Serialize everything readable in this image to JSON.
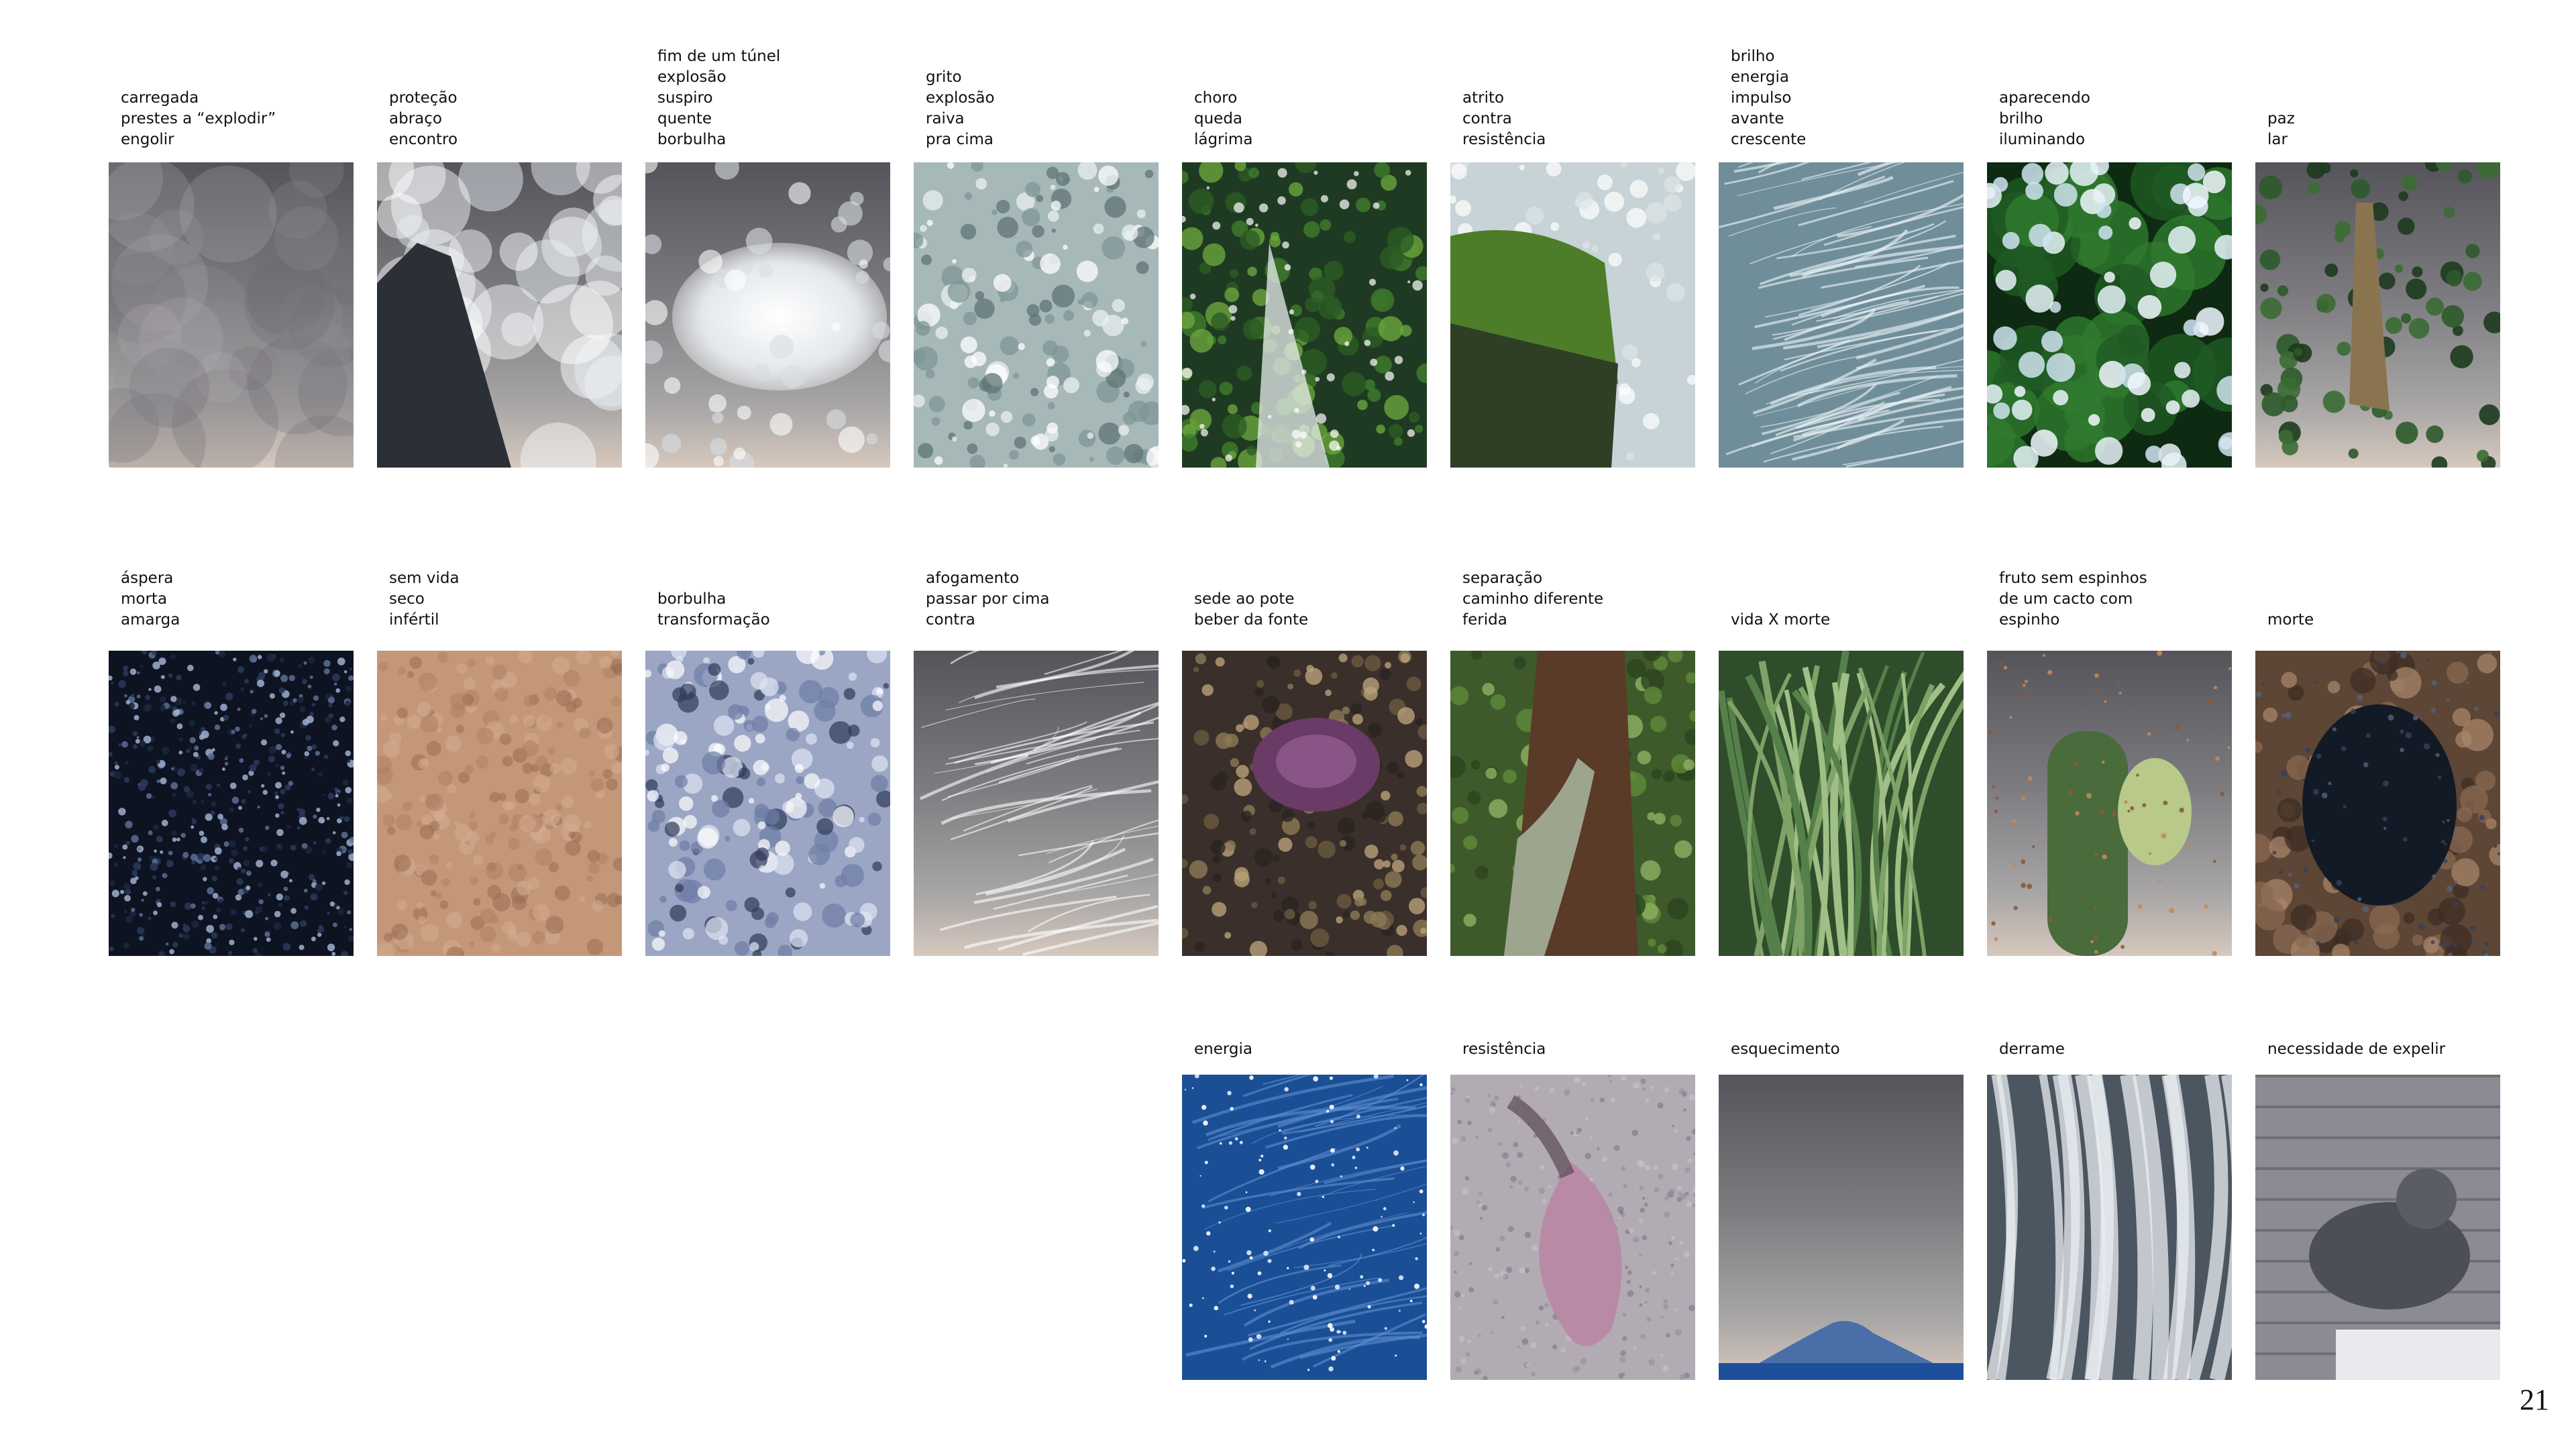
{
  "page_number": "21",
  "rows": [
    [
      {
        "lines": [
          "carregada",
          "prestes a “explodir”",
          "engolir"
        ],
        "photo": "cloudy-sky"
      },
      {
        "lines": [
          "proteção",
          "abraço",
          "encontro"
        ],
        "photo": "rock-in-mist"
      },
      {
        "lines": [
          "fim de um túnel",
          "explosão",
          "suspiro",
          "quente",
          "borbulha"
        ],
        "photo": "foam-over-rocks"
      },
      {
        "lines": [
          "grito",
          "explosão",
          "raiva",
          "pra cima"
        ],
        "photo": "water-splash"
      },
      {
        "lines": [
          "choro",
          "queda",
          "lágrima"
        ],
        "photo": "mossy-waterfall"
      },
      {
        "lines": [
          "atrito",
          "contra",
          "resistência"
        ],
        "photo": "wave-hitting-moss-rock"
      },
      {
        "lines": [
          "brilho",
          "energia",
          "impulso",
          "avante",
          "crescente"
        ],
        "photo": "streaking-water"
      },
      {
        "lines": [
          "aparecendo",
          "brilho",
          "iluminando"
        ],
        "photo": "bokeh-leaves"
      },
      {
        "lines": [
          "paz",
          "lar"
        ],
        "photo": "hanging-nest"
      }
    ],
    [
      {
        "lines": [
          "áspera",
          "morta",
          "amarga"
        ],
        "photo": "dark-seed-texture"
      },
      {
        "lines": [
          "sem vida",
          "seco",
          "infértil"
        ],
        "photo": "dry-sand-texture"
      },
      {
        "lines": [
          "borbulha",
          "transformação"
        ],
        "photo": "bubbles-texture"
      },
      {
        "lines": [
          "afogamento",
          "passar por cima",
          "contra"
        ],
        "photo": "wave-over-rock"
      },
      {
        "lines": [
          "sede ao pote",
          "beber da fonte"
        ],
        "photo": "crab-on-rock"
      },
      {
        "lines": [
          "separação",
          "caminho diferente",
          "ferida"
        ],
        "photo": "tree-trunk"
      },
      {
        "lines": [
          "vida X morte"
        ],
        "photo": "agave-plant"
      },
      {
        "lines": [
          "fruto sem espinhos",
          "de um cacto com",
          "espinho"
        ],
        "photo": "cactus-with-fruit"
      },
      {
        "lines": [
          "morte"
        ],
        "photo": "dark-seed-pod"
      }
    ],
    [
      {
        "lines": [
          "energia"
        ],
        "photo": "sparkling-sea"
      },
      {
        "lines": [
          "resistência"
        ],
        "photo": "pink-petal-on-sand"
      },
      {
        "lines": [
          "esquecimento"
        ],
        "photo": "distant-island"
      },
      {
        "lines": [
          "derrame"
        ],
        "photo": "white-streaked-rock"
      },
      {
        "lines": [
          "necessidade de expelir"
        ],
        "photo": "pigeon"
      }
    ]
  ]
}
